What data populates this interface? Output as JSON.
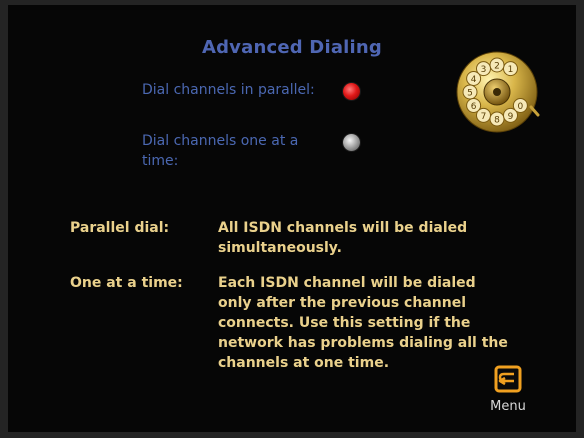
{
  "title": "Advanced Dialing",
  "options": [
    {
      "label": "Dial channels in parallel:",
      "selected": true
    },
    {
      "label": "Dial channels one at a time:",
      "selected": false
    }
  ],
  "descriptions": [
    {
      "term": "Parallel dial:",
      "text": "All ISDN channels will be dialed simultaneously."
    },
    {
      "term": "One at a time:",
      "text": "Each ISDN channel will be dialed only after the previous channel connects. Use this setting if the network has problems dialing all the channels at one time."
    }
  ],
  "dial": {
    "icon": "rotary-dial-icon",
    "digits": [
      "1",
      "2",
      "3",
      "4",
      "5",
      "6",
      "7",
      "8",
      "9",
      "0"
    ]
  },
  "menu": {
    "label": "Menu",
    "icon": "back-arrow-icon"
  },
  "colors": {
    "background": "#060606",
    "title": "#4f66b3",
    "option_label": "#4b68b2",
    "description": "#ead18c",
    "radio_on": "#e01818",
    "radio_off": "#a8a8a8",
    "menu_icon": "#f0a020"
  }
}
